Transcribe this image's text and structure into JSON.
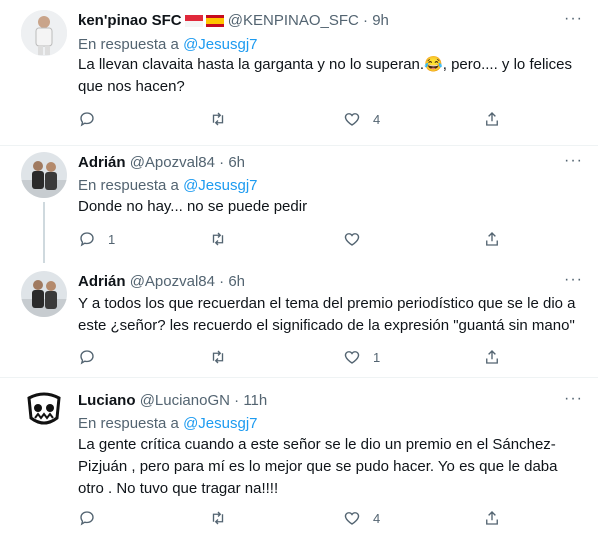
{
  "tweets": [
    {
      "name": "ken'pinao SFC",
      "handle": "@KENPINAO_SFC",
      "sep": "·",
      "time": "9h",
      "reply_prefix": "En respuesta a",
      "reply_to": "@Jesusgj7",
      "text": "La llevan clavaita hasta la garganta y no lo superan.😂, pero.... y lo felices que nos hacen?",
      "replies": "",
      "retweets": "",
      "likes": "4"
    },
    {
      "name": "Adrián",
      "handle": "@Apozval84",
      "sep": "·",
      "time": "6h",
      "reply_prefix": "En respuesta a",
      "reply_to": "@Jesusgj7",
      "text": "Donde no hay... no se puede pedir",
      "replies": "1",
      "retweets": "",
      "likes": ""
    },
    {
      "name": "Adrián",
      "handle": "@Apozval84",
      "sep": "·",
      "time": "6h",
      "text": "Y a todos los que recuerdan el tema del premio periodístico que se le dio a este ¿señor? les recuerdo el significado de la expresión \"guantá sin mano\"",
      "replies": "",
      "retweets": "",
      "likes": "1"
    },
    {
      "name": "Luciano",
      "handle": "@LucianoGN",
      "sep": "·",
      "time": "11h",
      "reply_prefix": "En respuesta a",
      "reply_to": "@Jesusgj7",
      "text": "La gente crítica cuando a este señor se le dio un premio en el Sánchez-Pizjuán , pero para mí es lo mejor que se pudo hacer. Yo es que le daba otro . No tuvo que tragar na!!!!",
      "replies": "",
      "retweets": "",
      "likes": "4"
    }
  ],
  "colors": {
    "accent": "#1d9bf0",
    "muted": "#536471",
    "text": "#0f1419",
    "divider": "#eff3f4"
  }
}
